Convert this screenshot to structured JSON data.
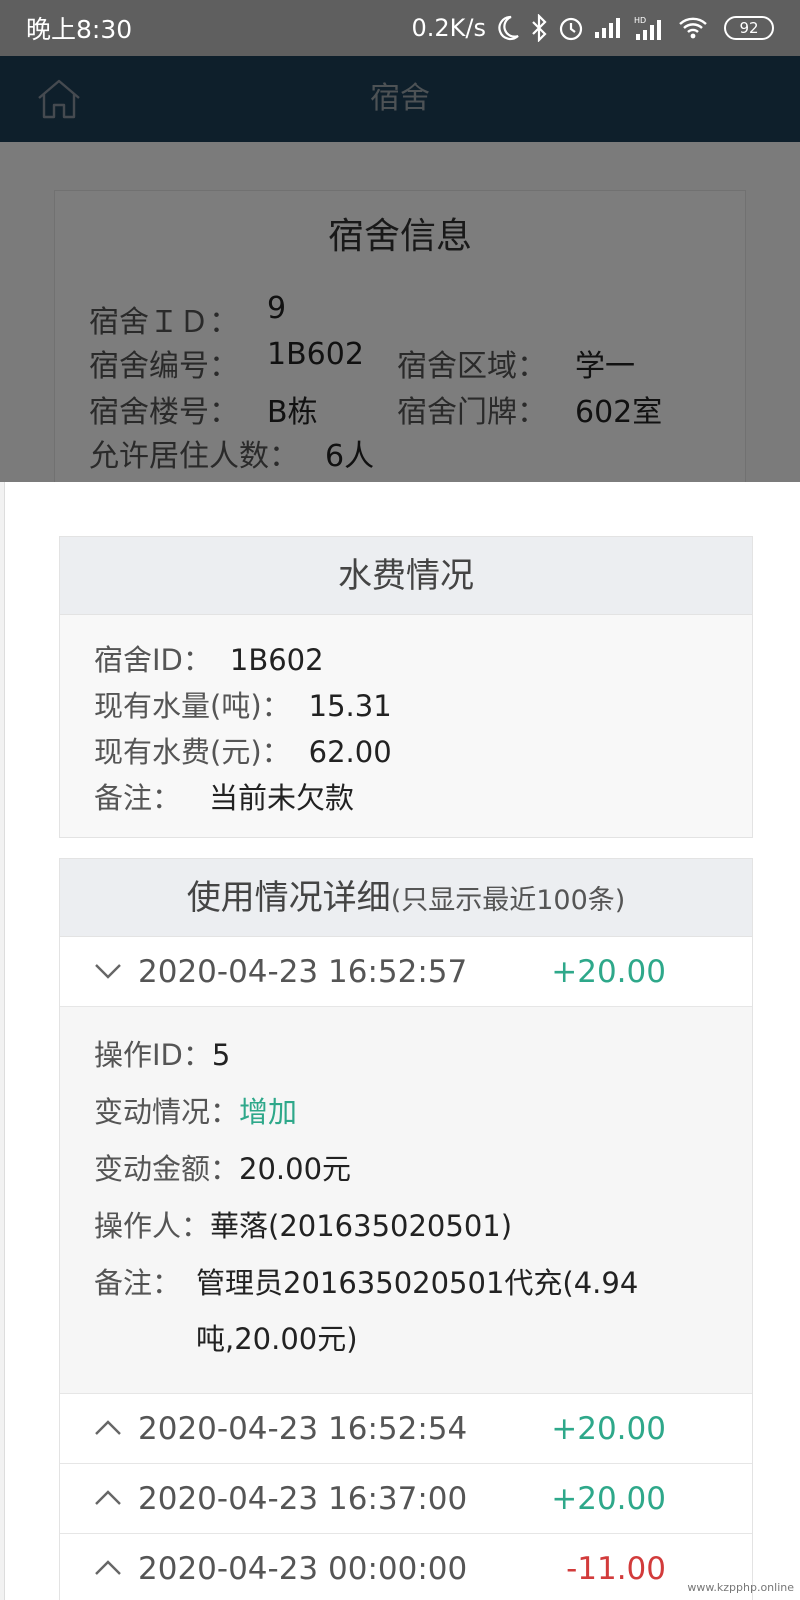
{
  "status_bar": {
    "time": "晚上8:30",
    "net_speed": "0.2K/s",
    "battery": "92",
    "hd": "HD"
  },
  "header": {
    "title": "宿舍",
    "home_icon": "home-icon"
  },
  "dorm_info": {
    "title": "宿舍信息",
    "id_label": "宿舍ＩＤ：",
    "id_value": "9",
    "number_label": "宿舍编号：",
    "number_value": "1B602",
    "area_label": "宿舍区域：",
    "area_value": "学一",
    "building_label": "宿舍楼号：",
    "building_value": "B栋",
    "door_label": "宿舍门牌：",
    "door_value": "602室",
    "capacity_label": "允许居住人数：",
    "capacity_value": "6人"
  },
  "water_fee": {
    "title": "水费情况",
    "dorm_id_label": "宿舍ID：",
    "dorm_id_value": "1B602",
    "water_label": "现有水量(吨)：",
    "water_value": "15.31",
    "fee_label": "现有水费(元)：",
    "fee_value": "62.00",
    "note_label": "备注：",
    "note_value": "当前未欠款"
  },
  "usage": {
    "title": "使用情况详细",
    "subtitle": "(只显示最近100条)",
    "records": [
      {
        "datetime": "2020-04-23 16:52:57",
        "amount": "+20.00",
        "expanded": true
      },
      {
        "datetime": "2020-04-23 16:52:54",
        "amount": "+20.00",
        "expanded": false
      },
      {
        "datetime": "2020-04-23 16:37:00",
        "amount": "+20.00",
        "expanded": false
      },
      {
        "datetime": "2020-04-23 00:00:00",
        "amount": "-11.00",
        "expanded": false
      }
    ],
    "detail": {
      "op_id_label": "操作ID：",
      "op_id_value": "5",
      "change_label": "变动情况：",
      "change_value": "增加",
      "amount_label": "变动金额：",
      "amount_value": "20.00元",
      "operator_label": "操作人：",
      "operator_value": "華落(201635020501)",
      "note_label": "备注：",
      "note_value": "管理员201635020501代充(4.94吨,20.00元)"
    }
  },
  "colors": {
    "header_bg": "#1d3e57",
    "positive": "#2ea88a",
    "negative": "#d23b3b"
  },
  "watermark": "www.kzpphp.online"
}
